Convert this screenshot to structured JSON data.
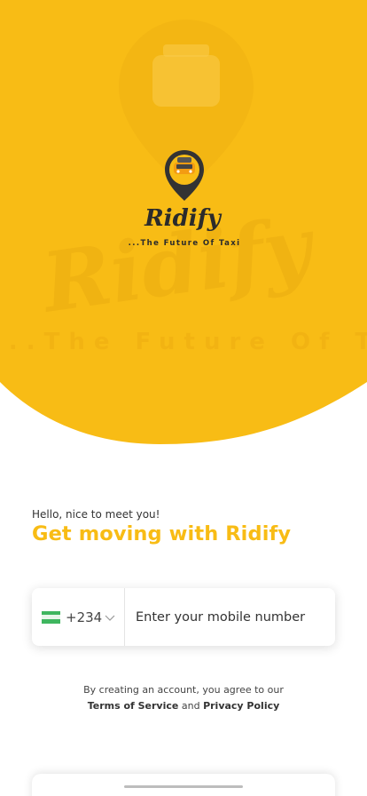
{
  "brand": {
    "logo_text": "Ridify",
    "logo_tagline": "...The Future Of Taxi",
    "watermark_tagline": "...The Future Of Taxi",
    "accent_color": "#f8bc15"
  },
  "welcome": {
    "greeting": "Hello, nice to meet you!",
    "headline": "Get moving with Ridify"
  },
  "phone_field": {
    "country_code": "+234",
    "country_flag_icon": "nigeria-flag-icon",
    "placeholder": "Enter your mobile number"
  },
  "terms": {
    "prefix": "By creating an account, you agree to our",
    "terms_link": "Terms of Service",
    "conjunction": "and",
    "privacy_link": "Privacy Policy"
  }
}
